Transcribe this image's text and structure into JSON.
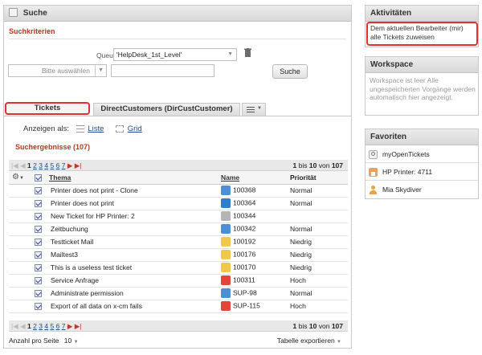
{
  "search_panel": {
    "title": "Suche",
    "criteria_label": "Suchkriterien",
    "queue_label": "Queue",
    "queue_value": "'HelpDesk_1st_Level'",
    "select_placeholder": "Bitte auswählen",
    "search_button": "Suche"
  },
  "tabs": [
    {
      "label": "Tickets"
    },
    {
      "label": "DirectCustomers (DirCustCustomer)"
    }
  ],
  "view": {
    "label": "Anzeigen als:",
    "list": "Liste",
    "grid": "Grid"
  },
  "results_label": "Suchergebnisse (107)",
  "pager": {
    "current": "1",
    "pages": [
      "2",
      "3",
      "4",
      "5",
      "6",
      "7"
    ],
    "range_from": "1",
    "range_bis": "bis",
    "range_to": "10",
    "range_von": "von",
    "total": "107"
  },
  "columns": {
    "thema": "Thema",
    "name": "Name",
    "priority": "Priorität"
  },
  "rows": [
    {
      "thema": "Printer does not print - Clone",
      "name": "100368",
      "priority": "Normal",
      "icon_color": "#4a90d9"
    },
    {
      "thema": "Printer does not print",
      "name": "100364",
      "priority": "Normal",
      "icon_color": "#2f7fd1"
    },
    {
      "thema": "New Ticket for HP Printer: 2",
      "name": "100344",
      "priority": "",
      "icon_color": "#b5b5b5"
    },
    {
      "thema": "Zeitbuchung",
      "name": "100342",
      "priority": "Normal",
      "icon_color": "#4a90d9"
    },
    {
      "thema": "Testticket Mail",
      "name": "100192",
      "priority": "Niedrig",
      "icon_color": "#f0c94a"
    },
    {
      "thema": "Mailtest3",
      "name": "100176",
      "priority": "Niedrig",
      "icon_color": "#f0c94a"
    },
    {
      "thema": "This is a useless test ticket",
      "name": "100170",
      "priority": "Niedrig",
      "icon_color": "#f0c94a"
    },
    {
      "thema": "Service Anfrage",
      "name": "100311",
      "priority": "Hoch",
      "icon_color": "#e0463a"
    },
    {
      "thema": "Administrate permission",
      "name": "SUP-98",
      "priority": "Normal",
      "icon_color": "#4a90d9"
    },
    {
      "thema": "Export of all data on x-cm fails",
      "name": "SUP-115",
      "priority": "Hoch",
      "icon_color": "#e0463a"
    }
  ],
  "footer": {
    "per_page_label": "Anzahl pro Seite",
    "per_page_value": "10",
    "export_label": "Tabelle exportieren"
  },
  "activities": {
    "title": "Aktivitäten",
    "text": "Dem aktuellen Bearbeiter (mir) alle Tickets zuweisen"
  },
  "workspace": {
    "title": "Workspace",
    "text": "Workspace ist leer Alle ungespeicherten Vorgänge werden automatisch hier angezeigt."
  },
  "favorites": {
    "title": "Favoriten",
    "items": [
      {
        "label": "myOpenTickets",
        "icon": "search-icon"
      },
      {
        "label": "HP Printer: 4711",
        "icon": "home-icon"
      },
      {
        "label": "Mia Skydiver",
        "icon": "person-icon"
      }
    ]
  },
  "colors": {
    "accent_red": "#b03a1e",
    "highlight": "#e03030",
    "link": "#1d4f8a"
  }
}
